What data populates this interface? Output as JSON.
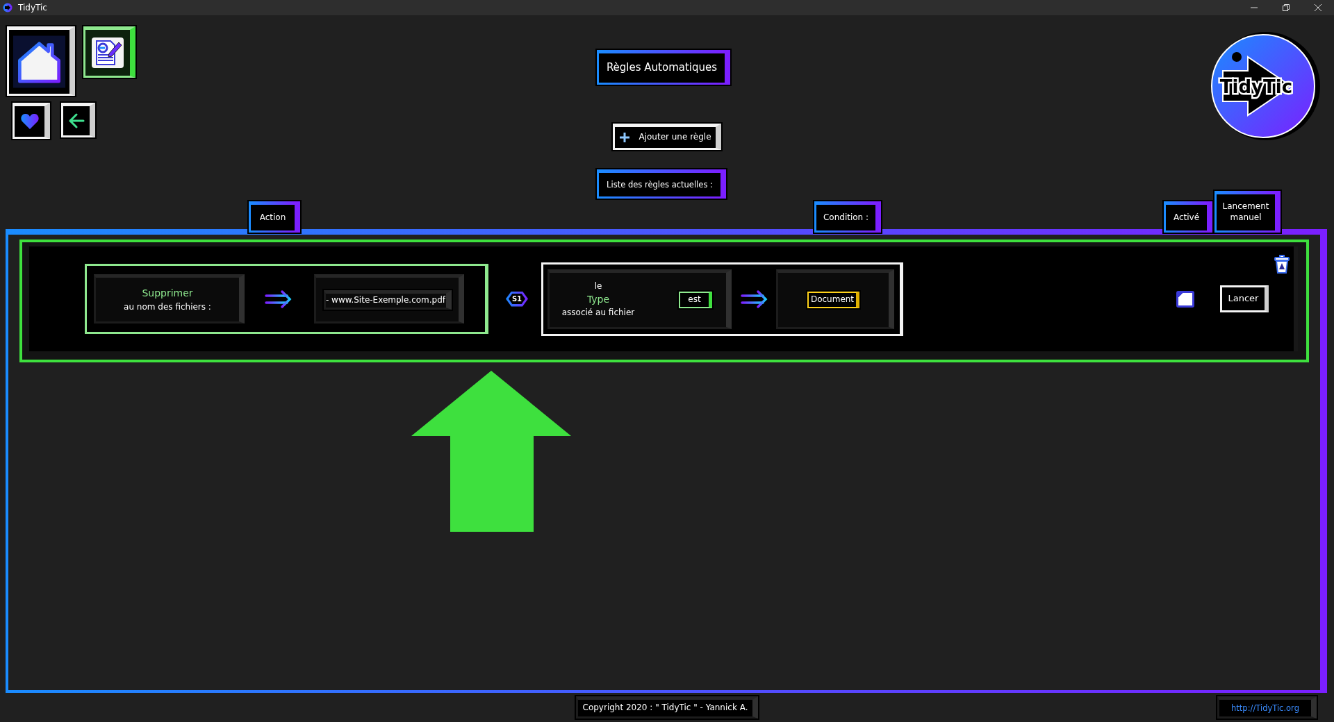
{
  "window": {
    "title": "TidyTic"
  },
  "logo_text": "TidyTic",
  "page_title": "Règles Automatiques",
  "add_button": "Ajouter une règle",
  "list_heading": "Liste des règles actuelles :",
  "columns": [
    "Action",
    "Condition :",
    "Activé",
    "Lancement manuel"
  ],
  "rules": [
    {
      "selected": true,
      "action": "Supprimer",
      "action_target": "au nom des fichiers :",
      "action_value": "- www.Site-Exemple.com.pdf",
      "badge": "S1",
      "condition_prefix": "le",
      "condition_field": "Type",
      "condition_suffix": "associé au fichier",
      "operator": "est",
      "condition_value": "Document",
      "active": false,
      "run_button": "Lancer"
    }
  ],
  "footer": {
    "copyright": "Copyright 2020 : \" TidyTic \" - Yannick A.",
    "link": "http://TidyTic.org"
  }
}
